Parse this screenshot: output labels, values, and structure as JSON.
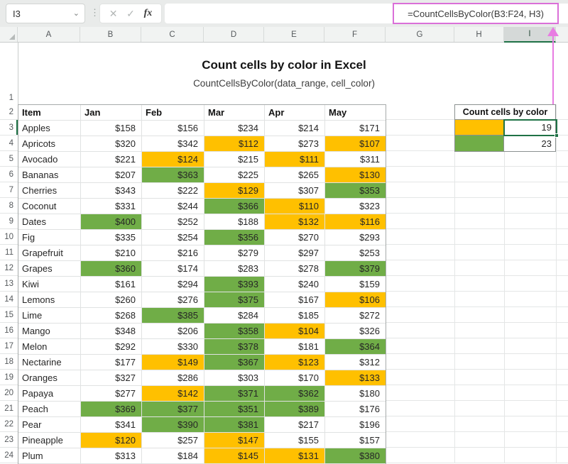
{
  "formula_bar": {
    "name_box": "I3",
    "chevron_icon": "⌄",
    "dots_icon": "⋮",
    "cancel_icon": "✕",
    "enter_icon": "✓",
    "fx_label": "fx",
    "formula": "=CountCellsByColor(B3:F24, H3)"
  },
  "column_headers": [
    "A",
    "B",
    "C",
    "D",
    "E",
    "F",
    "G",
    "H",
    "I"
  ],
  "selected_column": "I",
  "selected_row": "3",
  "selected_cell": "I3",
  "row_numbers": [
    "1",
    "2",
    "3",
    "4",
    "5",
    "6",
    "7",
    "8",
    "9",
    "10",
    "11",
    "12",
    "13",
    "14",
    "15",
    "16",
    "17",
    "18",
    "19",
    "20",
    "21",
    "22",
    "23",
    "24"
  ],
  "sheet_title": {
    "heading": "Count cells by color in Excel",
    "subtitle": "CountCellsByColor(data_range, cell_color)"
  },
  "table": {
    "headers": [
      "Item",
      "Jan",
      "Feb",
      "Mar",
      "Apr",
      "May"
    ],
    "rows": [
      {
        "row": "3",
        "item": "Apples",
        "values": [
          "$158",
          "$156",
          "$234",
          "$214",
          "$171"
        ],
        "fills": [
          "",
          "",
          "",
          "",
          ""
        ]
      },
      {
        "row": "4",
        "item": "Apricots",
        "values": [
          "$320",
          "$342",
          "$112",
          "$273",
          "$107"
        ],
        "fills": [
          "",
          "",
          "y",
          "",
          "y"
        ]
      },
      {
        "row": "5",
        "item": "Avocado",
        "values": [
          "$221",
          "$124",
          "$215",
          "$111",
          "$311"
        ],
        "fills": [
          "",
          "y",
          "",
          "y",
          ""
        ]
      },
      {
        "row": "6",
        "item": "Bananas",
        "values": [
          "$207",
          "$363",
          "$225",
          "$265",
          "$130"
        ],
        "fills": [
          "",
          "g",
          "",
          "",
          "y"
        ]
      },
      {
        "row": "7",
        "item": "Cherries",
        "values": [
          "$343",
          "$222",
          "$129",
          "$307",
          "$353"
        ],
        "fills": [
          "",
          "",
          "y",
          "",
          "g"
        ]
      },
      {
        "row": "8",
        "item": "Coconut",
        "values": [
          "$331",
          "$244",
          "$366",
          "$110",
          "$323"
        ],
        "fills": [
          "",
          "",
          "g",
          "y",
          ""
        ]
      },
      {
        "row": "9",
        "item": "Dates",
        "values": [
          "$400",
          "$252",
          "$188",
          "$132",
          "$116"
        ],
        "fills": [
          "g",
          "",
          "",
          "y",
          "y"
        ]
      },
      {
        "row": "10",
        "item": "Fig",
        "values": [
          "$335",
          "$254",
          "$356",
          "$270",
          "$293"
        ],
        "fills": [
          "",
          "",
          "g",
          "",
          ""
        ]
      },
      {
        "row": "11",
        "item": "Grapefruit",
        "values": [
          "$210",
          "$216",
          "$279",
          "$297",
          "$253"
        ],
        "fills": [
          "",
          "",
          "",
          "",
          ""
        ]
      },
      {
        "row": "12",
        "item": "Grapes",
        "values": [
          "$360",
          "$174",
          "$283",
          "$278",
          "$379"
        ],
        "fills": [
          "g",
          "",
          "",
          "",
          "g"
        ]
      },
      {
        "row": "13",
        "item": "Kiwi",
        "values": [
          "$161",
          "$294",
          "$393",
          "$240",
          "$159"
        ],
        "fills": [
          "",
          "",
          "g",
          "",
          ""
        ]
      },
      {
        "row": "14",
        "item": "Lemons",
        "values": [
          "$260",
          "$276",
          "$375",
          "$167",
          "$106"
        ],
        "fills": [
          "",
          "",
          "g",
          "",
          "y"
        ]
      },
      {
        "row": "15",
        "item": "Lime",
        "values": [
          "$268",
          "$385",
          "$284",
          "$185",
          "$272"
        ],
        "fills": [
          "",
          "g",
          "",
          "",
          ""
        ]
      },
      {
        "row": "16",
        "item": "Mango",
        "values": [
          "$348",
          "$206",
          "$358",
          "$104",
          "$326"
        ],
        "fills": [
          "",
          "",
          "g",
          "y",
          ""
        ]
      },
      {
        "row": "17",
        "item": "Melon",
        "values": [
          "$292",
          "$330",
          "$378",
          "$181",
          "$364"
        ],
        "fills": [
          "",
          "",
          "g",
          "",
          "g"
        ]
      },
      {
        "row": "18",
        "item": "Nectarine",
        "values": [
          "$177",
          "$149",
          "$367",
          "$123",
          "$312"
        ],
        "fills": [
          "",
          "y",
          "g",
          "y",
          ""
        ]
      },
      {
        "row": "19",
        "item": "Oranges",
        "values": [
          "$327",
          "$286",
          "$303",
          "$170",
          "$133"
        ],
        "fills": [
          "",
          "",
          "",
          "",
          "y"
        ]
      },
      {
        "row": "20",
        "item": "Papaya",
        "values": [
          "$277",
          "$142",
          "$371",
          "$362",
          "$180"
        ],
        "fills": [
          "",
          "y",
          "g",
          "g",
          ""
        ]
      },
      {
        "row": "21",
        "item": "Peach",
        "values": [
          "$369",
          "$377",
          "$351",
          "$389",
          "$176"
        ],
        "fills": [
          "g",
          "g",
          "g",
          "g",
          ""
        ]
      },
      {
        "row": "22",
        "item": "Pear",
        "values": [
          "$341",
          "$390",
          "$381",
          "$217",
          "$196"
        ],
        "fills": [
          "",
          "g",
          "g",
          "",
          ""
        ]
      },
      {
        "row": "23",
        "item": "Pineapple",
        "values": [
          "$120",
          "$257",
          "$147",
          "$155",
          "$157"
        ],
        "fills": [
          "y",
          "",
          "y",
          "",
          ""
        ]
      },
      {
        "row": "24",
        "item": "Plum",
        "values": [
          "$313",
          "$184",
          "$145",
          "$131",
          "$380"
        ],
        "fills": [
          "",
          "",
          "y",
          "y",
          "g"
        ]
      }
    ]
  },
  "count_panel": {
    "header": "Count cells by color",
    "rows": [
      {
        "color_name": "yellow",
        "fill": "#FFC000",
        "count": "19"
      },
      {
        "color_name": "green",
        "fill": "#70AD47",
        "count": "23"
      }
    ]
  },
  "colors": {
    "yellow": "#FFC000",
    "green": "#70AD47",
    "selection_green": "#1F7246",
    "arrow_pink": "#E87CE2"
  }
}
